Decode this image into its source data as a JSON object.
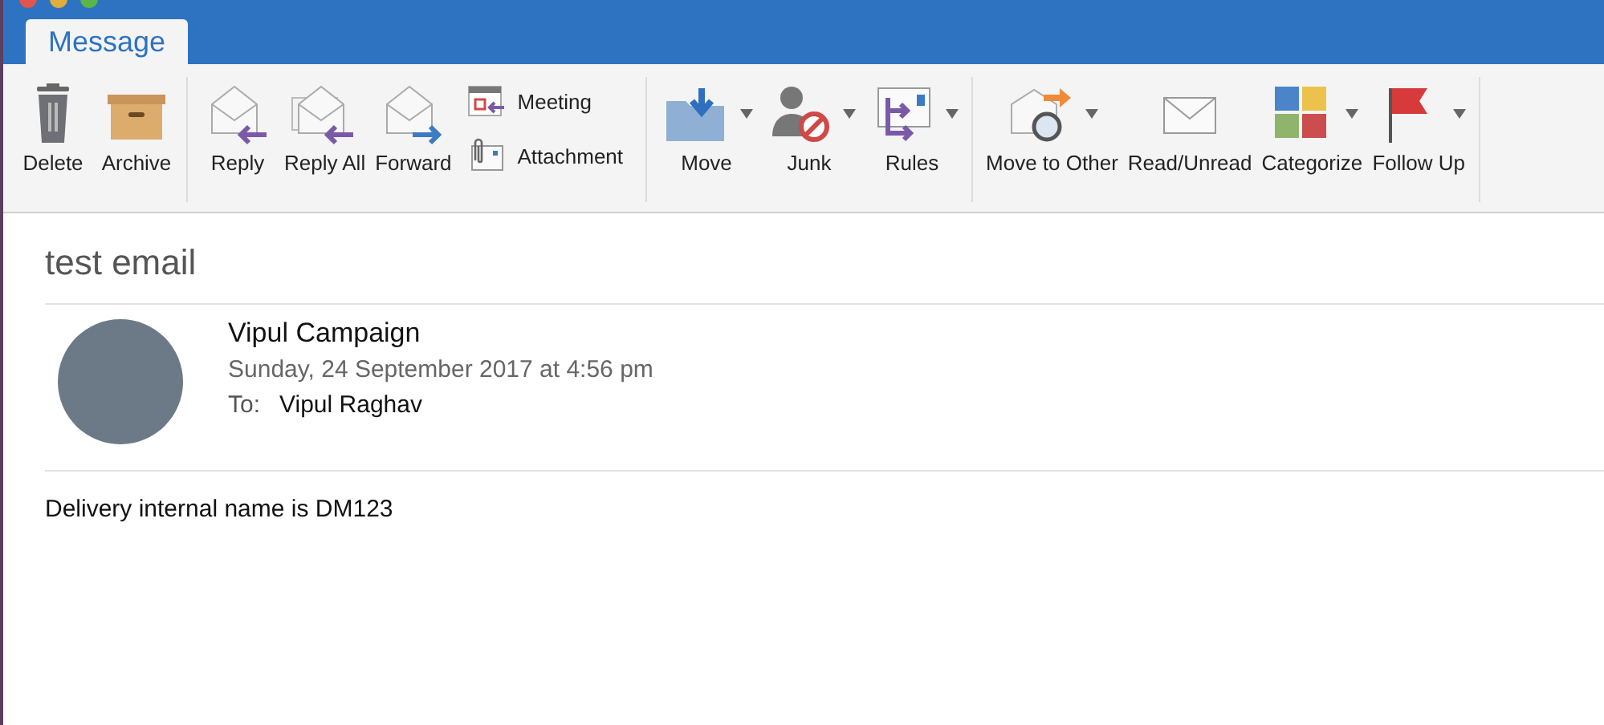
{
  "tabs": [
    {
      "label": "Message",
      "selected": true
    }
  ],
  "ribbon": {
    "groups": [
      {
        "buttons": [
          {
            "kind": "large",
            "label": "Delete",
            "dropdown": false
          },
          {
            "kind": "large",
            "label": "Archive",
            "dropdown": false
          }
        ]
      },
      {
        "buttons": [
          {
            "kind": "large",
            "label": "Reply",
            "dropdown": false
          },
          {
            "kind": "large",
            "label": "Reply All",
            "dropdown": false
          },
          {
            "kind": "large",
            "label": "Forward",
            "dropdown": false
          },
          {
            "kind": "small",
            "label": "Meeting"
          },
          {
            "kind": "small",
            "label": "Attachment"
          }
        ]
      },
      {
        "buttons": [
          {
            "kind": "large",
            "label": "Move",
            "dropdown": true
          },
          {
            "kind": "large",
            "label": "Junk",
            "dropdown": true
          },
          {
            "kind": "large",
            "label": "Rules",
            "dropdown": true
          }
        ]
      },
      {
        "buttons": [
          {
            "kind": "large",
            "label": "Move to Other",
            "dropdown": true
          },
          {
            "kind": "large",
            "label": "Read/Unread",
            "dropdown": false
          },
          {
            "kind": "large",
            "label": "Categorize",
            "dropdown": true
          },
          {
            "kind": "large",
            "label": "Follow Up",
            "dropdown": true
          }
        ]
      }
    ]
  },
  "message": {
    "subject": "test email",
    "sender": "Vipul Campaign",
    "date": "Sunday, 24 September 2017 at 4:56 pm",
    "to_label": "To:",
    "to": "Vipul Raghav",
    "body": "Delivery internal name is DM123"
  }
}
